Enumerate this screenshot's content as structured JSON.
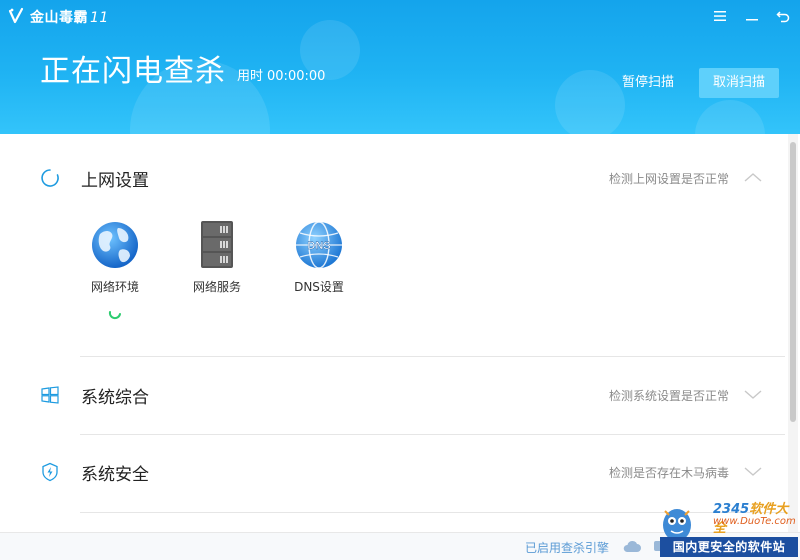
{
  "app": {
    "name": "金山毒霸",
    "version": "11"
  },
  "window_controls": {
    "menu_icon": "menu-icon",
    "minimize_icon": "minimize-icon",
    "restore_icon": "back-icon"
  },
  "scan": {
    "title": "正在闪电查杀",
    "elapsed_label": "用时",
    "elapsed_value": "00:00:00",
    "pause_label": "暂停扫描",
    "cancel_label": "取消扫描"
  },
  "sections": [
    {
      "title": "上网设置",
      "description": "检测上网设置是否正常",
      "icon": "loading-ring-icon",
      "expanded": true,
      "items": [
        {
          "label": "网络环境",
          "icon": "globe-icon",
          "scanning": true
        },
        {
          "label": "网络服务",
          "icon": "server-icon",
          "scanning": false
        },
        {
          "label": "DNS设置",
          "icon": "dns-globe-icon",
          "scanning": false
        }
      ]
    },
    {
      "title": "系统综合",
      "description": "检测系统设置是否正常",
      "icon": "windows-icon",
      "expanded": false
    },
    {
      "title": "系统安全",
      "description": "检测是否存在木马病毒",
      "icon": "shield-icon",
      "expanded": false
    }
  ],
  "footer": {
    "engine_text": "已启用查杀引擎",
    "icon": "cloud-icon"
  },
  "watermark": {
    "brand_num": "2345",
    "brand_text": "软件大全",
    "url": "www.DuoTe.com",
    "banner": "国内更安全的软件站"
  },
  "colors": {
    "header_top": "#14a4ec",
    "header_bottom": "#33c4fa",
    "accent_green": "#2dcc70",
    "link_blue": "#5b9bd5"
  }
}
